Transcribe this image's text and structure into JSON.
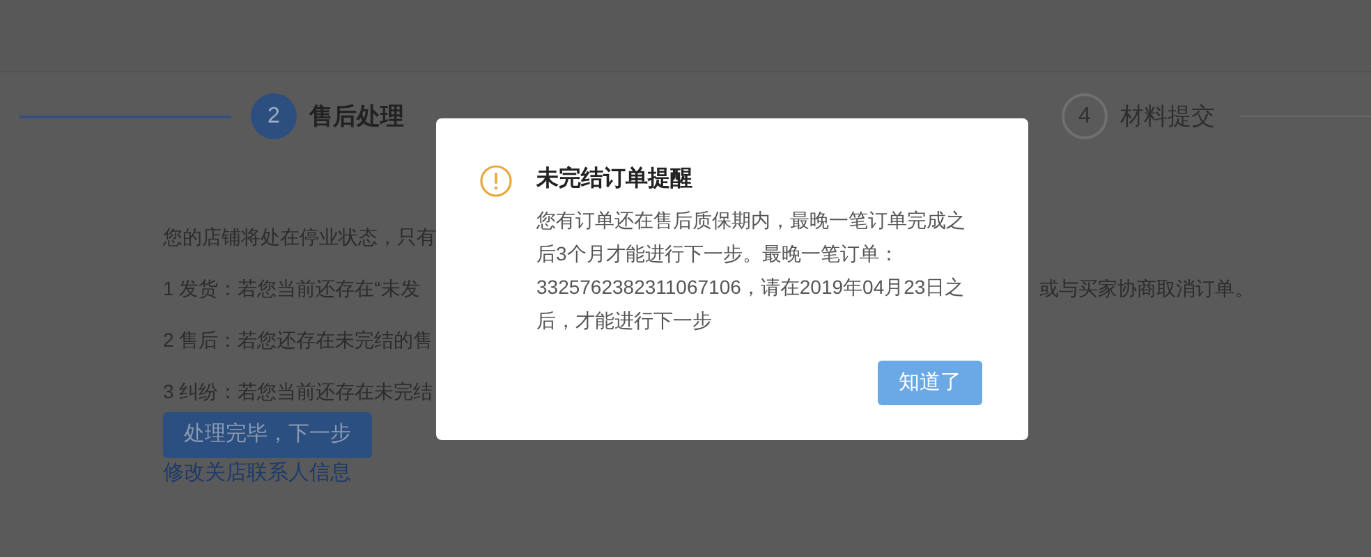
{
  "steps": [
    {
      "number": "2",
      "label": "售后处理",
      "selected": true
    },
    {
      "number": "4",
      "label": "材料提交",
      "selected": false
    }
  ],
  "content": {
    "intro": "您的店铺将处在停业状态，只有",
    "items": [
      {
        "text": "1 发货：若您当前还存在“未发",
        "continuation": "或与买家协商取消订单。"
      },
      {
        "text": "2 售后：若您还存在未完结的售"
      },
      {
        "text": "3 纠纷：若您当前还存在未完结"
      }
    ],
    "next_button": "处理完毕，下一步",
    "link": "修改关店联系人信息"
  },
  "dialog": {
    "title": "未完结订单提醒",
    "message": "您有订单还在售后质保期内，最晚一笔订单完成之后3个月才能进行下一步。最晚一笔订单：3325762382311067106，请在2019年04月23日之后，才能进行下一步",
    "button": "知道了"
  }
}
